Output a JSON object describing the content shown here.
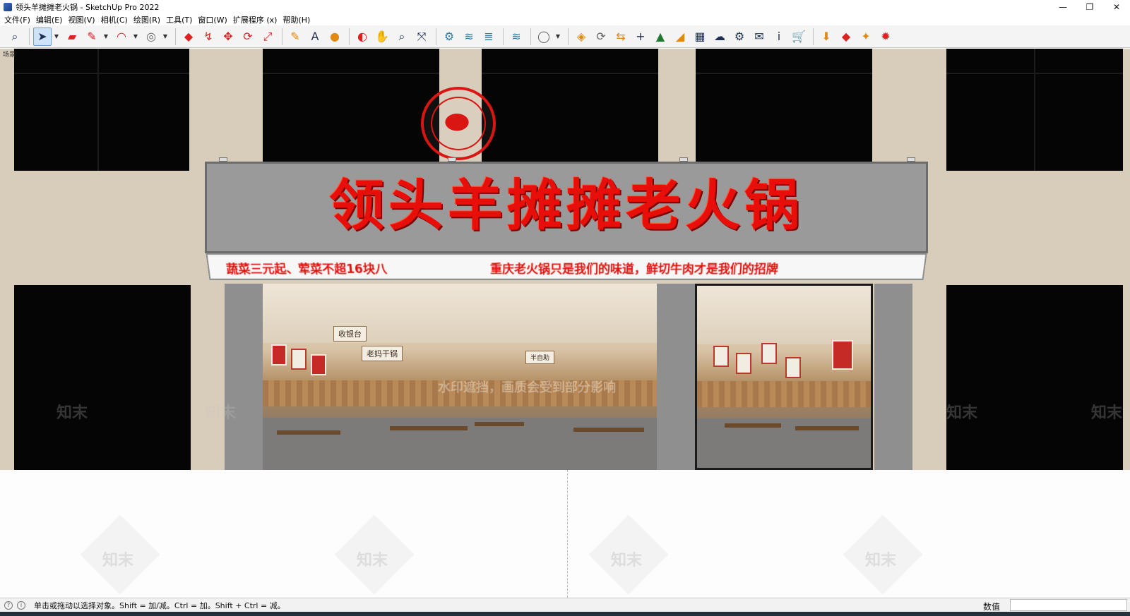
{
  "window": {
    "title": "领头羊摊摊老火锅 - SketchUp Pro 2022",
    "controls": {
      "minimize": "—",
      "restore": "❐",
      "close": "✕"
    }
  },
  "menu": [
    {
      "label": "文件(F)"
    },
    {
      "label": "编辑(E)"
    },
    {
      "label": "视图(V)"
    },
    {
      "label": "相机(C)"
    },
    {
      "label": "绘图(R)"
    },
    {
      "label": "工具(T)"
    },
    {
      "label": "窗口(W)"
    },
    {
      "label": "扩展程序 (x)"
    },
    {
      "label": "帮助(H)"
    }
  ],
  "toolbar": {
    "icons": {
      "search": "⌕",
      "select": "➤",
      "eraser": "▰",
      "pencil": "✎",
      "arc": "◠",
      "shapes": "◎",
      "pushpull": "◆",
      "followme": "↯",
      "move": "✥",
      "rotate": "⟳",
      "scale": "⤢",
      "tape": "✎",
      "text": "A",
      "paint": "●",
      "orbit": "◐",
      "pan": "✋",
      "zoom": "⌕",
      "zoomext": "⤧",
      "warehouse": "⚙",
      "components": "≋",
      "layers": "≣",
      "styles": "≋",
      "account": "◯",
      "ext1": "◈",
      "refresh": "⟳",
      "transfer": "⇆",
      "add": "+",
      "tree": "▲",
      "chart": "◢",
      "checker": "▦",
      "cloud": "☁",
      "gears": "⚙",
      "mail": "✉",
      "info": "i",
      "cart": "🛒",
      "download": "⬇",
      "layers2": "◆",
      "rocket": "✦",
      "settings": "✹"
    }
  },
  "scene": {
    "label": "场景",
    "signboard_title": "领头羊摊摊老火锅",
    "strip_left": "蔬菜三元起、荤菜不超16块八",
    "strip_right": "重庆老火锅只是我们的味道，鲜切牛肉才是我们的招牌",
    "inner_sign_1": "收银台",
    "inner_sign_2": "老妈干锅",
    "inner_sign_3": "半自助",
    "watermark_text": "知末",
    "watermark_notice": "水印遮挡，画质会受到部分影响"
  },
  "status": {
    "message": "单击或拖动以选择对象。Shift = 加/减。Ctrl = 加。Shift + Ctrl = 减。",
    "measurements_label": "数值",
    "measurements_value": ""
  },
  "colors": {
    "facade": "#d8ccbb",
    "sign_red": "#e80f0a",
    "sign_gray": "#9a9a9a",
    "window_black": "#050505"
  }
}
